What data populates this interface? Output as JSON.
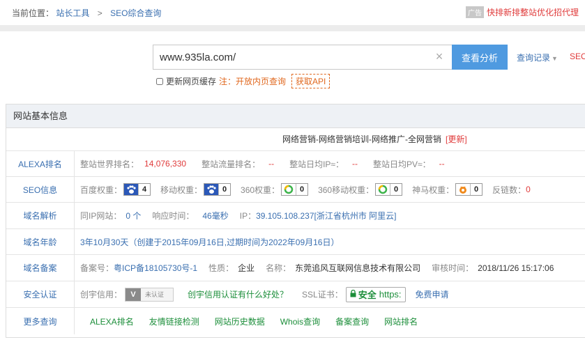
{
  "breadcrumb": {
    "prefix": "当前位置：",
    "items": [
      "站长工具",
      "SEO综合查询"
    ],
    "sep": ">"
  },
  "ad": {
    "tag": "广告",
    "text": "快排新排整站优化招代理"
  },
  "search": {
    "value": "www.935la.com/",
    "clear_icon": "×",
    "button": "查看分析",
    "history": "查询记录",
    "seo_cut": "SEO",
    "cache_label": "更新网页缓存",
    "note": "注：开放内页查询",
    "api": "获取API"
  },
  "panel": {
    "header": "网站基本信息",
    "site_title": "网络营销-网络营销培训-网络推广-全网营销",
    "update": "[更新]",
    "alexa": {
      "label": "ALEXA排名",
      "world_k": "整站世界排名：",
      "world_v": "14,076,330",
      "flow_k": "整站流量排名：",
      "flow_v": "--",
      "ip_k": "整站日均IP≈：",
      "ip_v": "--",
      "pv_k": "整站日均PV≈：",
      "pv_v": "--"
    },
    "seo": {
      "label": "SEO信息",
      "items": [
        {
          "k": "百度权重：",
          "icon": "baidu-paw-icon",
          "v": "4"
        },
        {
          "k": "移动权重：",
          "icon": "baidu-paw-icon",
          "v": "0"
        },
        {
          "k": "360权重：",
          "icon": "360-ring-icon",
          "v": "0"
        },
        {
          "k": "360移动权重：",
          "icon": "360-ring-icon",
          "v": "0"
        },
        {
          "k": "神马权重：",
          "icon": "shenma-horse-icon",
          "v": "0"
        }
      ],
      "backlink_k": "反链数：",
      "backlink_v": "0"
    },
    "dns": {
      "label": "域名解析",
      "sameip_k": "同IP网站：",
      "sameip_v": "0 个",
      "resp_k": "响应时间：",
      "resp_v": "46毫秒",
      "ip_k": "IP：",
      "ip_v": "39.105.108.237[浙江省杭州市 阿里云]"
    },
    "age": {
      "label": "域名年龄",
      "text": "3年10月30天（创建于2015年09月16日,过期时间为2022年09月16日）"
    },
    "icp": {
      "label": "域名备案",
      "no_k": "备案号：",
      "no_v": "粤ICP备18105730号-1",
      "type_k": "性质：",
      "type_v": "企业",
      "name_k": "名称：",
      "name_v": "东莞追风互联网信息技术有限公司",
      "time_k": "审核时间：",
      "time_v": "2018/11/26 15:17:06"
    },
    "cert": {
      "label": "安全认证",
      "cx_k": "创宇信用：",
      "cx_v": "V",
      "cx_t": "未认证",
      "cx_q": "创宇信用认证有什么好处？",
      "ssl_k": "SSL证书：",
      "ssl_sec": "安全",
      "ssl_https": "https:",
      "free": "免费申请"
    },
    "more": {
      "label": "更多查询",
      "links": [
        "ALEXA排名",
        "友情链接检测",
        "网站历史数据",
        "Whois查询",
        "备案查询",
        "网站排名"
      ]
    }
  },
  "colors": {
    "accent": "#4f9ae0",
    "link": "#3a6fb0",
    "red": "#e03b3b",
    "green": "#1c8e3a",
    "orange": "#e0681f"
  }
}
